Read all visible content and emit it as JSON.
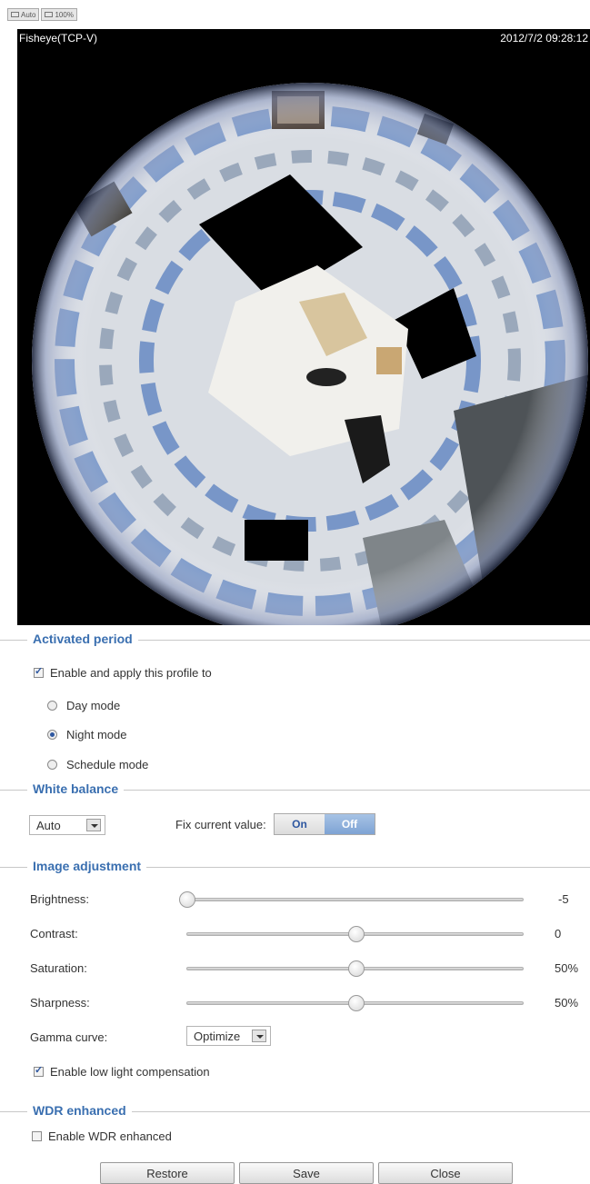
{
  "toolbar": {
    "auto_label": "Auto",
    "zoom_label": "100%"
  },
  "video": {
    "title": "Fisheye(TCP-V)",
    "timestamp": "2012/7/2 09:28:12"
  },
  "activated_period": {
    "title": "Activated period",
    "enable_label": "Enable and apply this profile to",
    "enable_checked": true,
    "modes": [
      {
        "label": "Day mode",
        "selected": false
      },
      {
        "label": "Night mode",
        "selected": true
      },
      {
        "label": "Schedule mode",
        "selected": false
      }
    ]
  },
  "white_balance": {
    "title": "White balance",
    "mode_value": "Auto",
    "fix_label": "Fix current value:",
    "on_label": "On",
    "off_label": "Off",
    "selected": "Off"
  },
  "image_adjustment": {
    "title": "Image adjustment",
    "brightness": {
      "label": "Brightness:",
      "value": "-5",
      "level": 0.0
    },
    "contrast": {
      "label": "Contrast:",
      "value": "0",
      "level": 0.5
    },
    "saturation": {
      "label": "Saturation:",
      "value": "50%",
      "level": 0.5
    },
    "sharpness": {
      "label": "Sharpness:",
      "value": "50%",
      "level": 0.5
    },
    "gamma": {
      "label": "Gamma curve:",
      "value": "Optimize"
    },
    "low_light_label": "Enable low light compensation",
    "low_light_checked": true
  },
  "wdr": {
    "title": "WDR enhanced",
    "enable_label": "Enable WDR enhanced",
    "enable_checked": false
  },
  "buttons": {
    "restore": "Restore",
    "save": "Save",
    "close": "Close"
  },
  "colors": {
    "accent": "#3a6fb0",
    "toggle_active": "#7ea3d4"
  }
}
